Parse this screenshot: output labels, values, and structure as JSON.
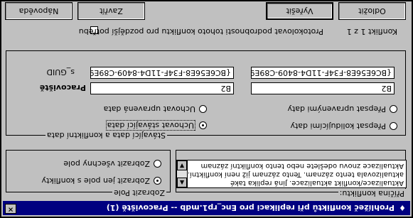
{
  "window": {
    "title": "Prohlížeč konfliktů při replikaci pro Enc_rp1.mdb -- Pracoviště (1)",
    "close_glyph": "×",
    "app_icon_glyph": "♦"
  },
  "reason_group": {
    "legend": "Příčina konfliktu:",
    "text_lines": [
      "Aktualizace/konflikt aktualizace. Jiná replika také",
      "aktualizovala tento záznam. Tento záznam již není konfliktní.",
      "Aktualizace znovu odešlete nebo tento konfliktní záznam"
    ]
  },
  "show_fields_group": {
    "legend": "Zobrazit Pole",
    "option_conflict_only": "Zobrazit jen pole s konflikty",
    "option_all": "Zobrazit všechny pole"
  },
  "matching_group": {
    "legend": "Stávající data a konfliktní data",
    "left_header": "Pracoviště",
    "s_guid_label": "s_GUID",
    "left_workstation_value": "B2",
    "left_guid_value": "{BC6E56E8-F34F-11D4-8409-C89E9",
    "right_workstation_value": "B2",
    "right_guid_value": "{BC6E56E8-F34F-11D4-8409-C89E9",
    "keep_existing": "Uchovat stávající data",
    "keep_modified": "Uchovat upravená data",
    "overwrite_conflict": "Přepsat kolidujícími daty",
    "overwrite_modified": "Přepsat upravenými daty"
  },
  "log_checkbox_label": "Protokolovat podrobnosti tohoto konfliktu pro pozdější potřebu",
  "conflict_counter": "Konflikt 1 z 1",
  "buttons": {
    "help": "Nápověda",
    "close": "Zavřít",
    "resolve": "Vyřešit",
    "postpone": "Odložit"
  }
}
